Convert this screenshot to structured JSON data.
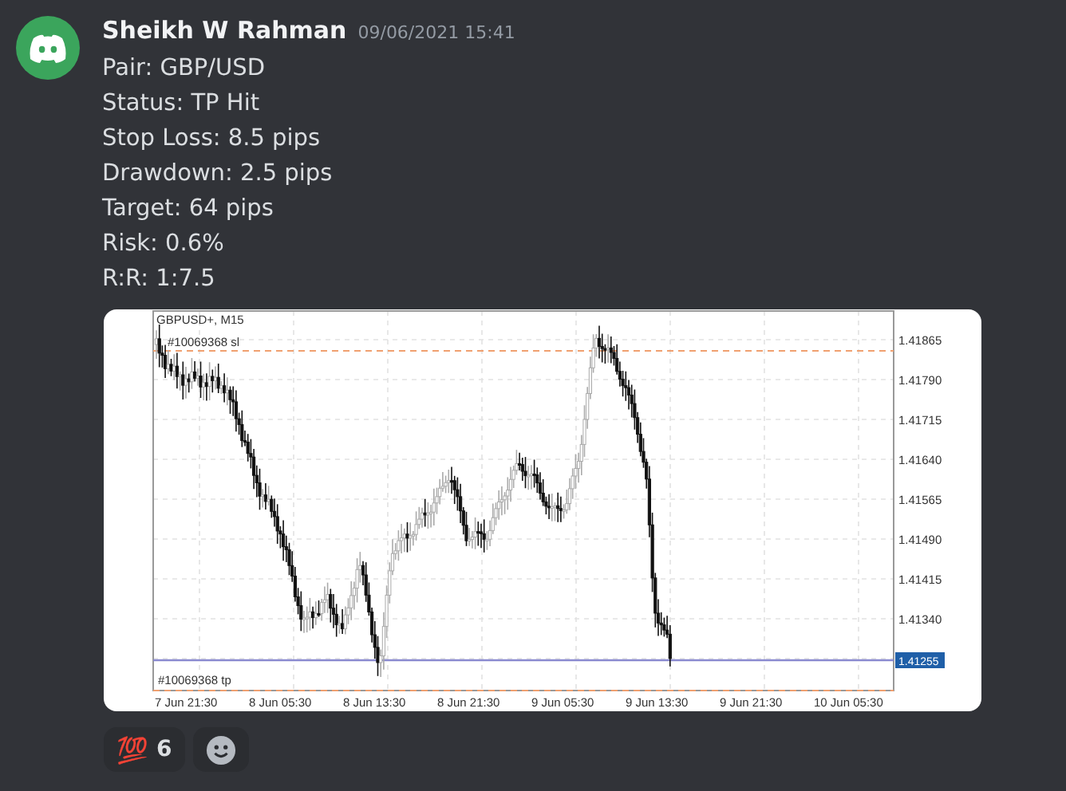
{
  "message": {
    "author": "Sheikh W Rahman",
    "timestamp": "09/06/2021 15:41",
    "lines": [
      "Pair: GBP/USD",
      "Status: TP Hit",
      "Stop Loss: 8.5 pips",
      "Drawdown: 2.5 pips",
      "Target: 64 pips",
      "Risk: 0.6%",
      "R:R: 1:7.5"
    ],
    "attachment": {
      "title": "GBPUSD+, M15",
      "sl_label": "#10069368 sl",
      "tp_label": "#10069368 tp",
      "y_ticks": [
        "1.41865",
        "1.41790",
        "1.41715",
        "1.41640",
        "1.41565",
        "1.41490",
        "1.41415",
        "1.41340"
      ],
      "price_label": "1.41255",
      "x_labels": [
        "7 Jun 21:30",
        "8 Jun 05:30",
        "8 Jun 13:30",
        "8 Jun 21:30",
        "9 Jun 05:30",
        "9 Jun 13:30",
        "9 Jun 21:30",
        "10 Jun 05:30"
      ]
    },
    "reactions": [
      {
        "kind": "emoji",
        "emoji": "💯",
        "count": "6"
      },
      {
        "kind": "add"
      }
    ]
  }
}
